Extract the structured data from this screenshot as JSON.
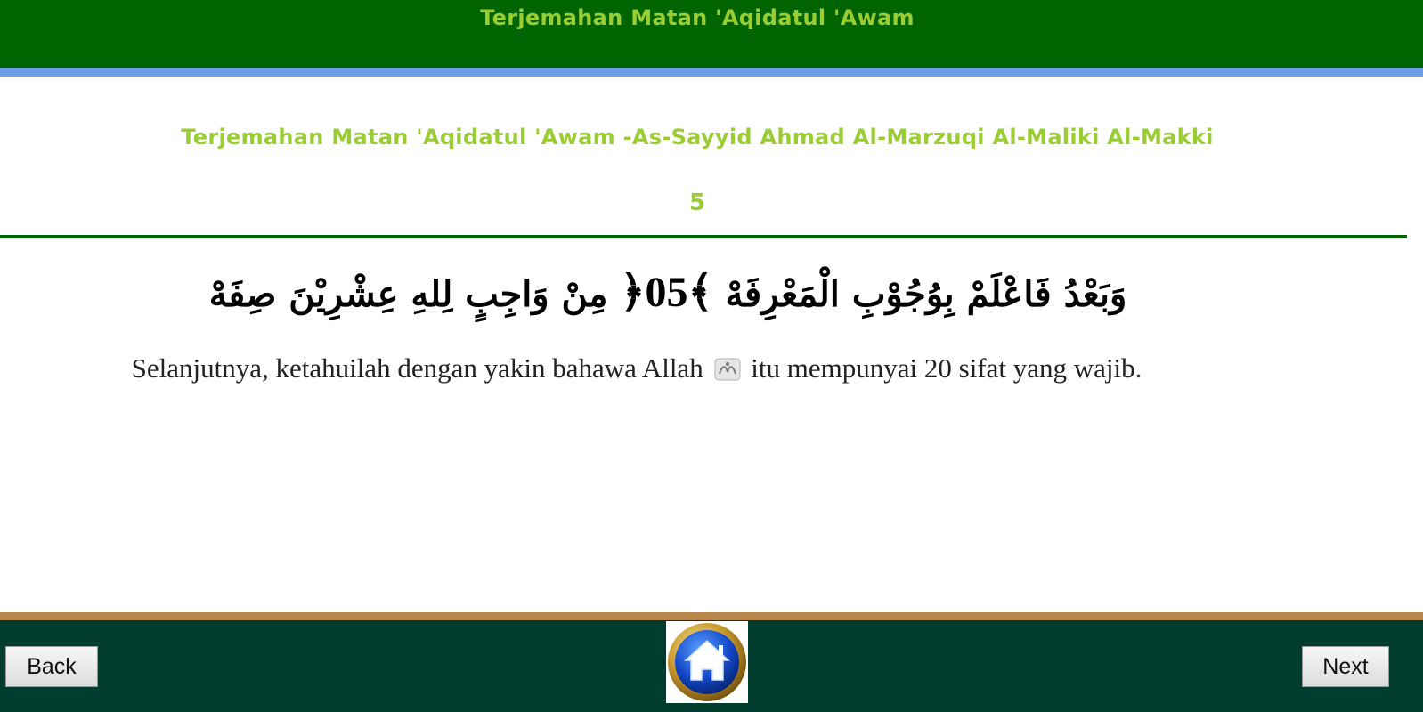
{
  "header": {
    "title": "Terjemahan Matan 'Aqidatul 'Awam"
  },
  "content": {
    "subtitle": "Terjemahan Matan 'Aqidatul 'Awam -As-Sayyid Ahmad Al-Marzuqi Al-Maliki Al-Makki",
    "page_number": "5",
    "arabic_before": "وَبَعْدُ فَاعْلَمْ بِوُجُوْبِ الْمَعْرِفَهْ",
    "verse_number": "05",
    "arabic_after": "مِنْ وَاجِبٍ لِلهِ عِشْرِيْنَ صِفَهْ",
    "translation_before": "Selanjutnya, ketahuilah dengan yakin bahawa Allah",
    "translation_after": "itu mempunyai 20 sifat yang wajib."
  },
  "footer": {
    "back_label": "Back",
    "next_label": "Next"
  },
  "icons": {
    "home": "home-icon",
    "honorific": "swt-honorific-icon"
  },
  "colors": {
    "header_bg": "#006400",
    "title_text": "#9acd32",
    "header_stripe": "#6f9ee8",
    "footer_bg": "#003d2e",
    "footer_stripe": "#b8854a"
  }
}
